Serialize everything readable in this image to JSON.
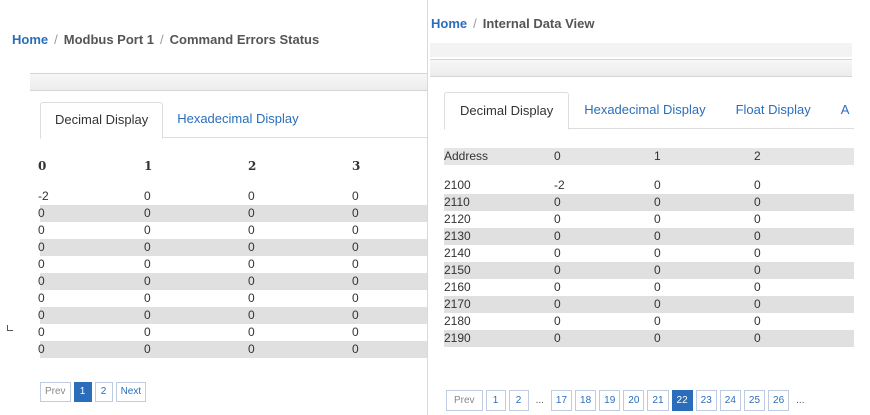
{
  "left": {
    "breadcrumb": {
      "home": "Home",
      "crumb1": "Modbus Port 1",
      "crumb2": "Command Errors Status"
    },
    "tabs": [
      "Decimal Display",
      "Hexadecimal Display"
    ],
    "headers": [
      "0",
      "1",
      "2",
      "3"
    ],
    "rows": [
      [
        "-2",
        "0",
        "0",
        "0"
      ],
      [
        "0",
        "0",
        "0",
        "0"
      ],
      [
        "0",
        "0",
        "0",
        "0"
      ],
      [
        "0",
        "0",
        "0",
        "0"
      ],
      [
        "0",
        "0",
        "0",
        "0"
      ],
      [
        "0",
        "0",
        "0",
        "0"
      ],
      [
        "0",
        "0",
        "0",
        "0"
      ],
      [
        "0",
        "0",
        "0",
        "0"
      ],
      [
        "0",
        "0",
        "0",
        "0"
      ],
      [
        "0",
        "0",
        "0",
        "0"
      ]
    ],
    "pager": {
      "prev": "Prev",
      "pages": [
        "1",
        "2"
      ],
      "active": "1",
      "next": "Next"
    }
  },
  "right": {
    "breadcrumb": {
      "home": "Home",
      "crumb1": "Internal Data View"
    },
    "tabs": [
      "Decimal Display",
      "Hexadecimal Display",
      "Float Display",
      "A"
    ],
    "headers": [
      "Address",
      "0",
      "1",
      "2"
    ],
    "rows": [
      [
        "2100",
        "-2",
        "0",
        "0"
      ],
      [
        "2110",
        "0",
        "0",
        "0"
      ],
      [
        "2120",
        "0",
        "0",
        "0"
      ],
      [
        "2130",
        "0",
        "0",
        "0"
      ],
      [
        "2140",
        "0",
        "0",
        "0"
      ],
      [
        "2150",
        "0",
        "0",
        "0"
      ],
      [
        "2160",
        "0",
        "0",
        "0"
      ],
      [
        "2170",
        "0",
        "0",
        "0"
      ],
      [
        "2180",
        "0",
        "0",
        "0"
      ],
      [
        "2190",
        "0",
        "0",
        "0"
      ]
    ],
    "pager": {
      "prev": "Prev",
      "pages": [
        "1",
        "2",
        "...",
        "17",
        "18",
        "19",
        "20",
        "21",
        "22",
        "23",
        "24",
        "25",
        "26",
        "..."
      ],
      "active": "22"
    }
  }
}
